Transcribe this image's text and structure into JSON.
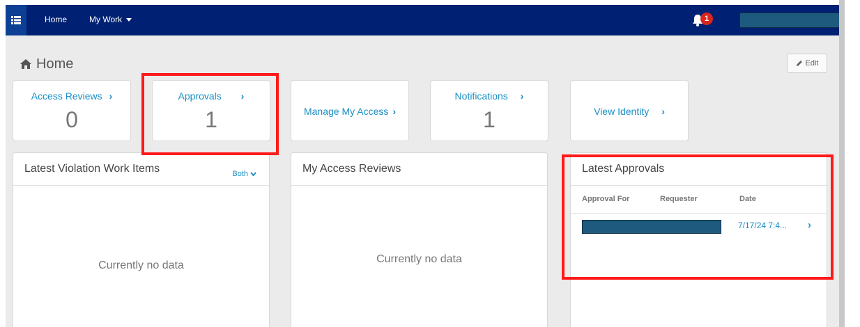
{
  "nav": {
    "home_label": "Home",
    "mywork_label": "My Work",
    "notification_count": "1"
  },
  "page": {
    "title": "Home",
    "edit_label": "Edit"
  },
  "tiles": [
    {
      "label": "Access Reviews",
      "count": "0"
    },
    {
      "label": "Approvals",
      "count": "1"
    },
    {
      "label": "Manage My Access"
    },
    {
      "label": "Notifications",
      "count": "1"
    },
    {
      "label": "View Identity"
    }
  ],
  "panels": {
    "violations": {
      "title": "Latest Violation Work Items",
      "filter": "Both",
      "empty": "Currently no data"
    },
    "access_reviews": {
      "title": "My Access Reviews",
      "empty": "Currently no data"
    },
    "approvals": {
      "title": "Latest Approvals",
      "columns": [
        "Approval For",
        "Requester",
        "Date"
      ],
      "rows": [
        {
          "date": "7/17/24 7:4..."
        }
      ]
    }
  },
  "colors": {
    "nav_bg": "#002173",
    "accent": "#1a8fc4",
    "highlight": "#ff1a1a"
  }
}
